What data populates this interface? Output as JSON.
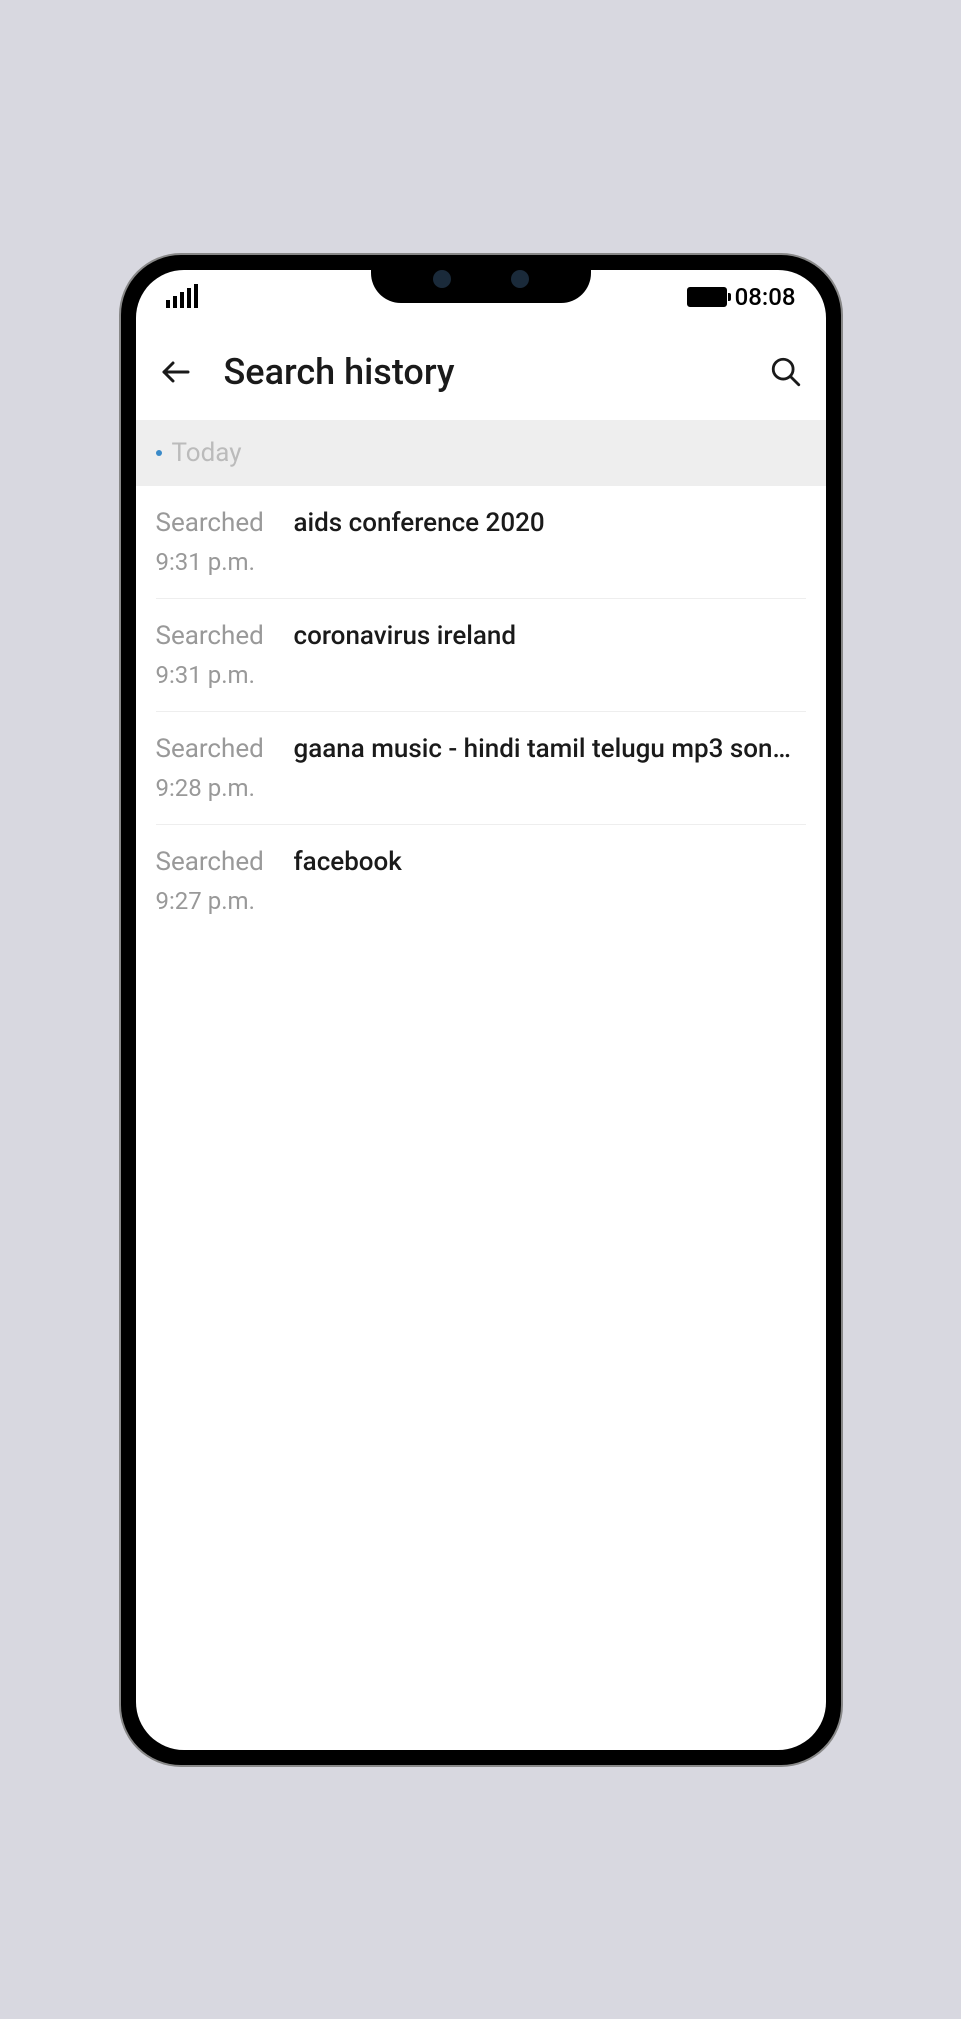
{
  "status_bar": {
    "time": "08:08"
  },
  "header": {
    "title": "Search history"
  },
  "day_section": {
    "label": "Today"
  },
  "searched_label": "Searched",
  "history": [
    {
      "query": "aids conference 2020",
      "time": "9:31 p.m."
    },
    {
      "query": "coronavirus ireland",
      "time": "9:31 p.m."
    },
    {
      "query": "gaana music - hindi tamil telugu mp3 son...",
      "time": "9:28 p.m."
    },
    {
      "query": "facebook",
      "time": "9:27 p.m."
    }
  ]
}
